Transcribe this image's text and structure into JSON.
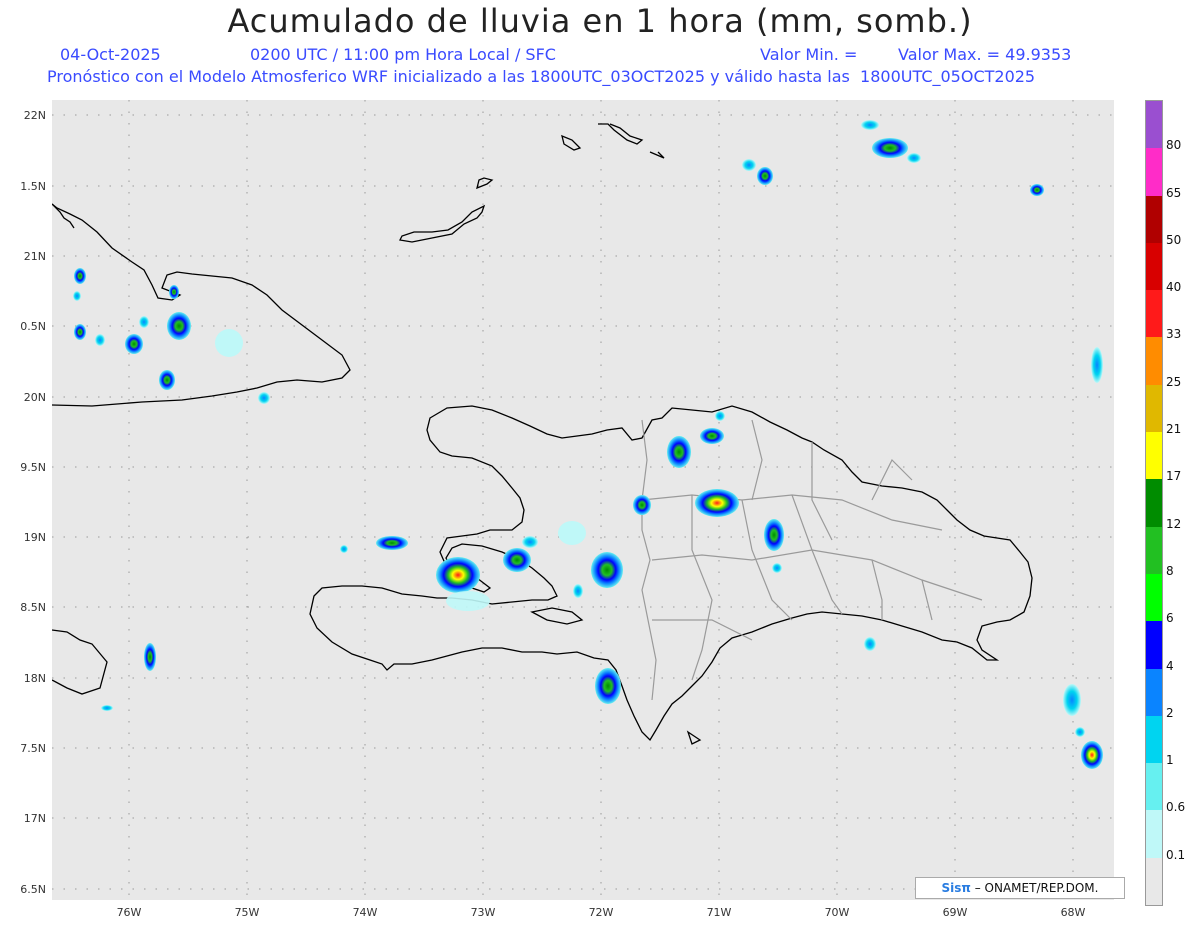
{
  "title": "Acumulado de lluvia en 1 hora (mm, somb.)",
  "subtitle": {
    "date": "04-Oct-2025",
    "time": "0200 UTC / 11:00 pm Hora Local / SFC",
    "min_label": "Valor Min. =",
    "max_label": "Valor Max. = 49.9353",
    "model": "Pronóstico con el Modelo Atmosferico WRF inicializado a las 1800UTC_03OCT2025 y válido hasta las  1800UTC_05OCT2025"
  },
  "lat_ticks": [
    "22N",
    "1.5N",
    "21N",
    "0.5N",
    "20N",
    "9.5N",
    "19N",
    "8.5N",
    "18N",
    "7.5N",
    "17N",
    "6.5N"
  ],
  "lon_ticks": [
    "76W",
    "75W",
    "74W",
    "73W",
    "72W",
    "71W",
    "70W",
    "69W",
    "68W"
  ],
  "colorbar": {
    "labels": [
      "80",
      "65",
      "50",
      "40",
      "33",
      "25",
      "21",
      "17",
      "12",
      "8",
      "6",
      "4",
      "2",
      "1",
      "0.6",
      "0.1"
    ],
    "colors": [
      "#9a4fd0",
      "#ff2cc8",
      "#b00000",
      "#d80000",
      "#ff1a1a",
      "#ff8c00",
      "#e0b800",
      "#ffff00",
      "#008c00",
      "#22c022",
      "#00ff00",
      "#0000ff",
      "#0a84ff",
      "#00d4f0",
      "#66f0f0",
      "#bff8f8",
      "#e8e8e8"
    ]
  },
  "credit": {
    "brand": "Sisπ",
    "text": " – ONAMET/REP.DOM."
  }
}
